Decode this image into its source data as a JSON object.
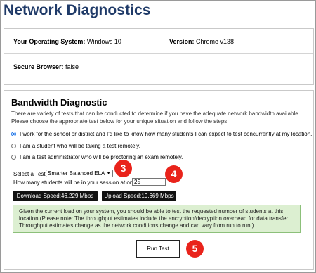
{
  "page": {
    "title": "Network Diagnostics"
  },
  "system_info": {
    "os_label": "Your Operating System:",
    "os_value": "Windows 10",
    "version_label": "Version:",
    "version_value": "Chrome v138",
    "secure_label": "Secure Browser:",
    "secure_value": "false"
  },
  "bandwidth": {
    "title": "Bandwidth Diagnostic",
    "description": "There are variety of tests that can be conducted to determine if you have the adequate network bandwidth available. Please choose the appropriate test below for your unique situation and follow the steps.",
    "options": [
      {
        "label": "I work for the school or district and I'd like to know how many students I can expect to test concurrently at my location.",
        "checked": true
      },
      {
        "label": "I am a student who will be taking a test remotely.",
        "checked": false
      },
      {
        "label": "I am a test administrator who will be proctoring an exam remotely.",
        "checked": false
      }
    ],
    "select_test_label": "Select a Test:",
    "select_test_value": "Smarter Balanced ELA",
    "students_label": "How many students will be in your session at once?",
    "students_value": "25",
    "download_speed": "Download Speed:46.229 Mbps",
    "upload_speed": "Upload Speed:19.669 Mbps",
    "result_message": "Given the current load on your system, you should be able to test the requested number of students at this location.(Please note: The throughput estimates include the encryption/decryption overhead for data transfer. Throughput estimates change as the network conditions change and can vary from run to run.)",
    "run_button": "Run Test"
  },
  "step_markers": {
    "three": "3",
    "four": "4",
    "five": "5",
    "color": "#e9231b"
  },
  "colors": {
    "title": "#1f3a68",
    "result_bg": "#dcefd1",
    "result_border": "#8cc07a",
    "speed_badge": "#111111"
  }
}
